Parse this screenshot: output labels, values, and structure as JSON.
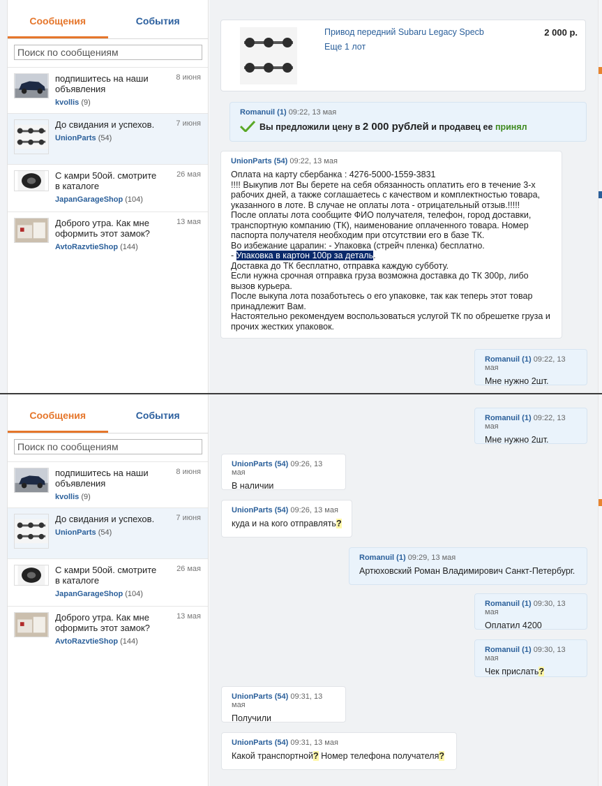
{
  "tabs": {
    "messages": "Сообщения",
    "events": "События"
  },
  "search": {
    "placeholder": "Поиск по сообщениям"
  },
  "conversations": [
    {
      "text": "подпишитесь на наши объявления",
      "date": "8 июня",
      "user": "kvollis",
      "count": "(9)",
      "thumb": "car-photo"
    },
    {
      "text": "До свидания и успехов.",
      "date": "7 июня",
      "user": "UnionParts",
      "count": "(54)",
      "thumb": "driveshaft-photo"
    },
    {
      "text": "С камри 50ой. смотрите в каталоге",
      "date": "26 мая",
      "user": "JapanGarageShop",
      "count": "(104)",
      "thumb": "wheel-photo"
    },
    {
      "text": "Доброго утра. Как мне оформить этот замок?",
      "date": "13 мая",
      "user": "AvtoRazvtieShop",
      "count": "(144)",
      "thumb": "parts-box-photo"
    }
  ],
  "lot": {
    "title": "Привод передний Subaru Legacy Specb",
    "more": "Еще 1 лот",
    "price": "2 000 р."
  },
  "offer": {
    "user": "Romanuil (1)",
    "time": "09:22, 13 мая",
    "text_before": "Вы предложили цену в",
    "amount": "2 000 рублей",
    "text_mid": "и продавец ее",
    "status": "принял"
  },
  "long_message": {
    "user": "UnionParts (54)",
    "time": "09:22, 13 мая",
    "lines": [
      "Оплата на карту сбербанка : 4276-5000-1559-3831",
      "!!!! Выкупив лот Вы берете на себя обязанность оплатить его в течение 3-х рабочих дней, а также соглашаетесь с качеством и комплектностью товара, указанного в лоте. В случае не оплаты лота - отрицательный отзыв.!!!!!",
      "После оплаты лота сообщите ФИО получателя, телефон, город доставки, транспортную компанию (ТК), наименование оплаченного товара. Номер паспорта получателя необходим при отсутствии его в базе ТК.",
      "Во избежание царапин: - Упаковка (стрейч пленка) бесплатно."
    ],
    "dash": "- ",
    "highlighted": "Упаковка в картон 100р за деталь",
    "dot": ".",
    "lines_after": [
      "Доставка до ТК бесплатно, отправка каждую субботу.",
      "Если нужна срочная отправка груза возможна доставка до ТК 300р, либо вызов курьера.",
      "После выкупа лота позаботьтесь о его упаковке, так как теперь этот товар принадлежит Вам.",
      "Настоятельно рекомендуем воспользоваться услугой ТК по обрешетке груза и прочих жестких упаковок."
    ]
  },
  "msg_need": {
    "user": "Romanuil (1)",
    "time": "09:22, 13 мая",
    "text": "Мне нужно 2шт."
  },
  "msg_avail": {
    "user": "UnionParts (54)",
    "time": "09:26, 13 мая",
    "text": "В наличии"
  },
  "msg_where": {
    "user": "UnionParts (54)",
    "time": "09:26, 13 мая",
    "text": "куда и на кого отправлять",
    "mark": "?"
  },
  "msg_name": {
    "user": "Romanuil (1)",
    "time": "09:29, 13 мая",
    "text": "Артюховский Роман Владимирович Санкт-Петербург."
  },
  "msg_paid": {
    "user": "Romanuil (1)",
    "time": "09:30, 13 мая",
    "text": "Оплатил 4200"
  },
  "msg_check": {
    "user": "Romanuil (1)",
    "time": "09:30, 13 мая",
    "text": "Чек прислать",
    "mark": "?"
  },
  "msg_got": {
    "user": "UnionParts (54)",
    "time": "09:31, 13 мая",
    "text": "Получили"
  },
  "msg_which": {
    "user": "UnionParts (54)",
    "time": "09:31, 13 мая",
    "text1": "Какой транспортной",
    "mark1": "?",
    "text2": " Номер телефона получателя",
    "mark2": "?"
  },
  "colors": {
    "accent": "#e5762b",
    "link": "#2a5f9a",
    "accepted": "#3f8a1f",
    "bg_main": "#f0f2f4"
  }
}
